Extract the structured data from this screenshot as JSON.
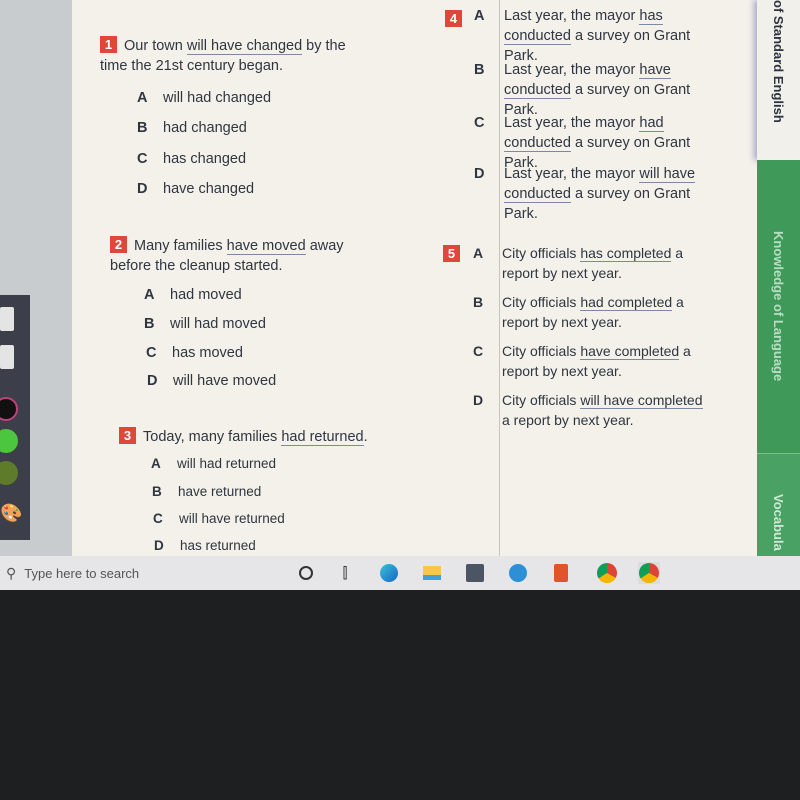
{
  "left_toolbar": {
    "icons": [
      "dropdown-icon",
      "square-icon",
      "black-pen-swatch",
      "green-pen-swatch",
      "olive-pen-swatch",
      "palette-icon"
    ],
    "colors": [
      "#111111",
      "#4cc63f",
      "#5e7a2b"
    ]
  },
  "questions": [
    {
      "num": "1",
      "pre": "Our town ",
      "u": "will have changed",
      "post": " by the time the 21st century began.",
      "options": [
        {
          "letter": "A",
          "text": "will had changed"
        },
        {
          "letter": "B",
          "text": "had changed"
        },
        {
          "letter": "C",
          "text": "has changed"
        },
        {
          "letter": "D",
          "text": "have changed"
        }
      ]
    },
    {
      "num": "2",
      "pre": "Many families ",
      "u": "have moved",
      "post": " away before the cleanup started.",
      "options": [
        {
          "letter": "A",
          "text": "had moved"
        },
        {
          "letter": "B",
          "text": "will had moved"
        },
        {
          "letter": "C",
          "text": "has moved"
        },
        {
          "letter": "D",
          "text": "will have moved"
        }
      ]
    },
    {
      "num": "3",
      "pre": "Today, many families ",
      "u": "had returned",
      "post": ".",
      "options": [
        {
          "letter": "A",
          "text": "will had returned"
        },
        {
          "letter": "B",
          "text": "have returned"
        },
        {
          "letter": "C",
          "text": "will have returned"
        },
        {
          "letter": "D",
          "text": "has returned"
        }
      ]
    },
    {
      "num": "4",
      "options": [
        {
          "letter": "A",
          "pre": "Last year, the mayor ",
          "u": "has conducted",
          "post": " a survey on Grant Park."
        },
        {
          "letter": "B",
          "pre": "Last year, the mayor ",
          "u": "have conducted",
          "post": " a survey on Grant Park."
        },
        {
          "letter": "C",
          "pre": "Last year, the mayor ",
          "u": "had conducted",
          "post": " a survey on Grant Park."
        },
        {
          "letter": "D",
          "pre": "Last year, the mayor ",
          "u": "will have conducted",
          "post": " a survey on Grant Park."
        }
      ]
    },
    {
      "num": "5",
      "options": [
        {
          "letter": "A",
          "pre": "City officials ",
          "u": "has completed",
          "post": " a report by next year."
        },
        {
          "letter": "B",
          "pre": "City officials ",
          "u": "had completed",
          "post": " a report by next year."
        },
        {
          "letter": "C",
          "pre": "City officials ",
          "u": "have completed",
          "post": " a report by next year."
        },
        {
          "letter": "D",
          "pre": "City officials ",
          "u": "will have completed",
          "post": " a report by next year."
        }
      ]
    }
  ],
  "side_tabs": [
    {
      "label": "of Standard English",
      "color": "#f2f0ea"
    },
    {
      "label": "Knowledge of Language",
      "color": "#3f9a5a"
    },
    {
      "label": "Vocabula",
      "color": "#4aa164"
    }
  ],
  "taskbar": {
    "search_placeholder": "Type here to search",
    "icons": [
      "cortana-icon",
      "task-view-icon",
      "edge-icon",
      "file-explorer-icon",
      "store-icon",
      "tool-app-icon",
      "office-icon",
      "chrome-icon",
      "chrome-profile-icon"
    ]
  },
  "accent": "#e0473b"
}
